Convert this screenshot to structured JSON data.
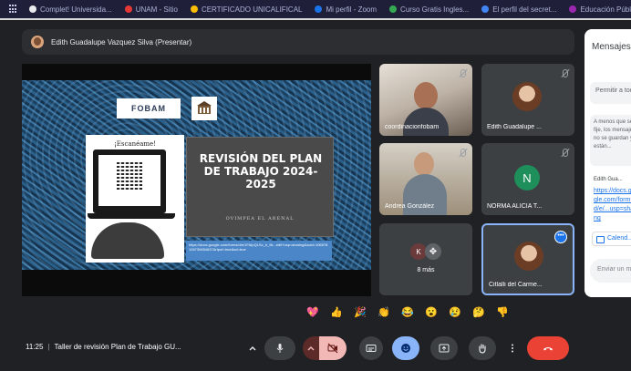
{
  "bookmarks": [
    {
      "label": "Complet! Universida...",
      "color": "#e8eaed"
    },
    {
      "label": "UNAM - Sitio",
      "color": "#e53935"
    },
    {
      "label": "CERTIFICADO UNICALIFICAL",
      "color": "#fbbc04"
    },
    {
      "label": "Mi perfil - Zoom",
      "color": "#1a73e8"
    },
    {
      "label": "Curso Gratis Ingles...",
      "color": "#34a853"
    },
    {
      "label": "El perfil del secret...",
      "color": "#4285f4"
    },
    {
      "label": "Educación Pública...",
      "color": "#9c27b0"
    }
  ],
  "presenter": {
    "name": "Edith Guadalupe Vazquez Silva (Presentar)"
  },
  "slide": {
    "logo": "FOBAM",
    "qr_caption": "¡Escanéame!",
    "title": "REVISIÓN DEL PLAN DE TRABAJO 2024-2025",
    "subtitle": "OVIMPEA EL ARENAL",
    "link": "https://docs.google.com/forms/d/e/1FAIpQLSc_b_9k...edit?usp=sharing&ouid=106578126730654637&rtpof=true&sd=true"
  },
  "participants": [
    {
      "name": "coordinacionfobam",
      "kind": "video"
    },
    {
      "name": "Edith Guadalupe ...",
      "kind": "photo"
    },
    {
      "name": "Andrea González",
      "kind": "video"
    },
    {
      "name": "NORMA ALICIA T...",
      "kind": "initial",
      "initial": "N"
    },
    {
      "name": "8 más",
      "kind": "more",
      "initial": "K"
    },
    {
      "name": "Citlalli del Carme...",
      "kind": "photo"
    }
  ],
  "chat": {
    "title": "Mensajes",
    "notice": "Permitir a todos...",
    "info": "A menos que se fije, los mensajes no se guardan y están...",
    "sender": "Edith Gua...",
    "message_link": "https://docs.google.com/forms/d/e/...usp=sharing",
    "chip_label": "Calend...",
    "input_placeholder": "Enviar un mensaje"
  },
  "reactions": [
    "💖",
    "👍",
    "🎉",
    "👏",
    "😂",
    "😮",
    "😢",
    "🤔",
    "👎"
  ],
  "bottom": {
    "time": "11:25",
    "meeting_title": "Taller de revisión Plan de Trabajo GU..."
  }
}
